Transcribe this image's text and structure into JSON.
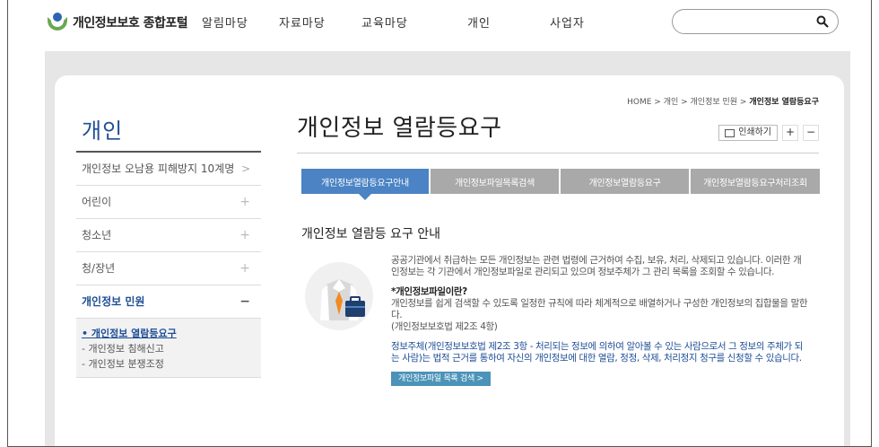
{
  "header": {
    "logo_text": "개인정보보호 종합포털",
    "nav": [
      "알림마당",
      "자료마당",
      "교육마당",
      "개인",
      "사업자"
    ],
    "search": {
      "value": "",
      "placeholder": ""
    }
  },
  "sidebar": {
    "title": "개인",
    "items": [
      {
        "label": "개인정보 오남용 피해방지 10계명",
        "mark": ">"
      },
      {
        "label": "어린이",
        "mark": "+"
      },
      {
        "label": "청소년",
        "mark": "+"
      },
      {
        "label": "청/장년",
        "mark": "+"
      },
      {
        "label": "개인정보 민원",
        "mark": "−"
      }
    ],
    "subitems": [
      "• 개인정보 열람등요구",
      "- 개인정보 침해신고",
      "- 개인정보 분쟁조정"
    ]
  },
  "main": {
    "breadcrumb": {
      "parts": "HOME > 개인 > 개인정보 민원 > ",
      "current": "개인정보 열람등요구"
    },
    "title": "개인정보 열람등요구",
    "print_label": "인쇄하기",
    "zoom_in": "+",
    "zoom_out": "−",
    "tabs": [
      "개인정보열람등요구안내",
      "개인정보파일목록검색",
      "개인정보열람등요구",
      "개인정보열람등요구처리조회"
    ],
    "section_title": "개인정보 열람등 요구 안내",
    "para1": "공공기관에서 취급하는 모든 개인정보는 관련 법령에 근거하여 수집, 보유, 처리, 삭제되고 있습니다. 이러한 개인정보는 각 기관에서 개인정보파일로 관리되고 있으며 정보주체가 그 관리 목록을 조회할 수 있습니다.",
    "para2_heading": "*개인정보파일이란?",
    "para2": "개인정보를 쉽게 검색할 수 있도록 일정한 규칙에 따라 체계적으로 배열하거나 구성한 개인정보의 집합물을 말한다.",
    "para2_ref": "(개인정보보호법 제2조 4항)",
    "para3": "정보주체(개인정보보호법 제2조 3항 - 처리되는 정보에 의하여 알아볼 수 있는 사람으로서 그 정보의 주체가 되는 사람)는 법적 근거를 통하여 자신의 개인정보에 대한 열람, 정정, 삭제, 처리정지 청구를 신청할 수 있습니다.",
    "link_button": "개인정보파일 목록 검색 >"
  },
  "colors": {
    "accent": "#4b83c4",
    "brand_blue": "#1f4e96",
    "tab_gray": "#a9a9a9",
    "link_button": "#4b93b8"
  }
}
